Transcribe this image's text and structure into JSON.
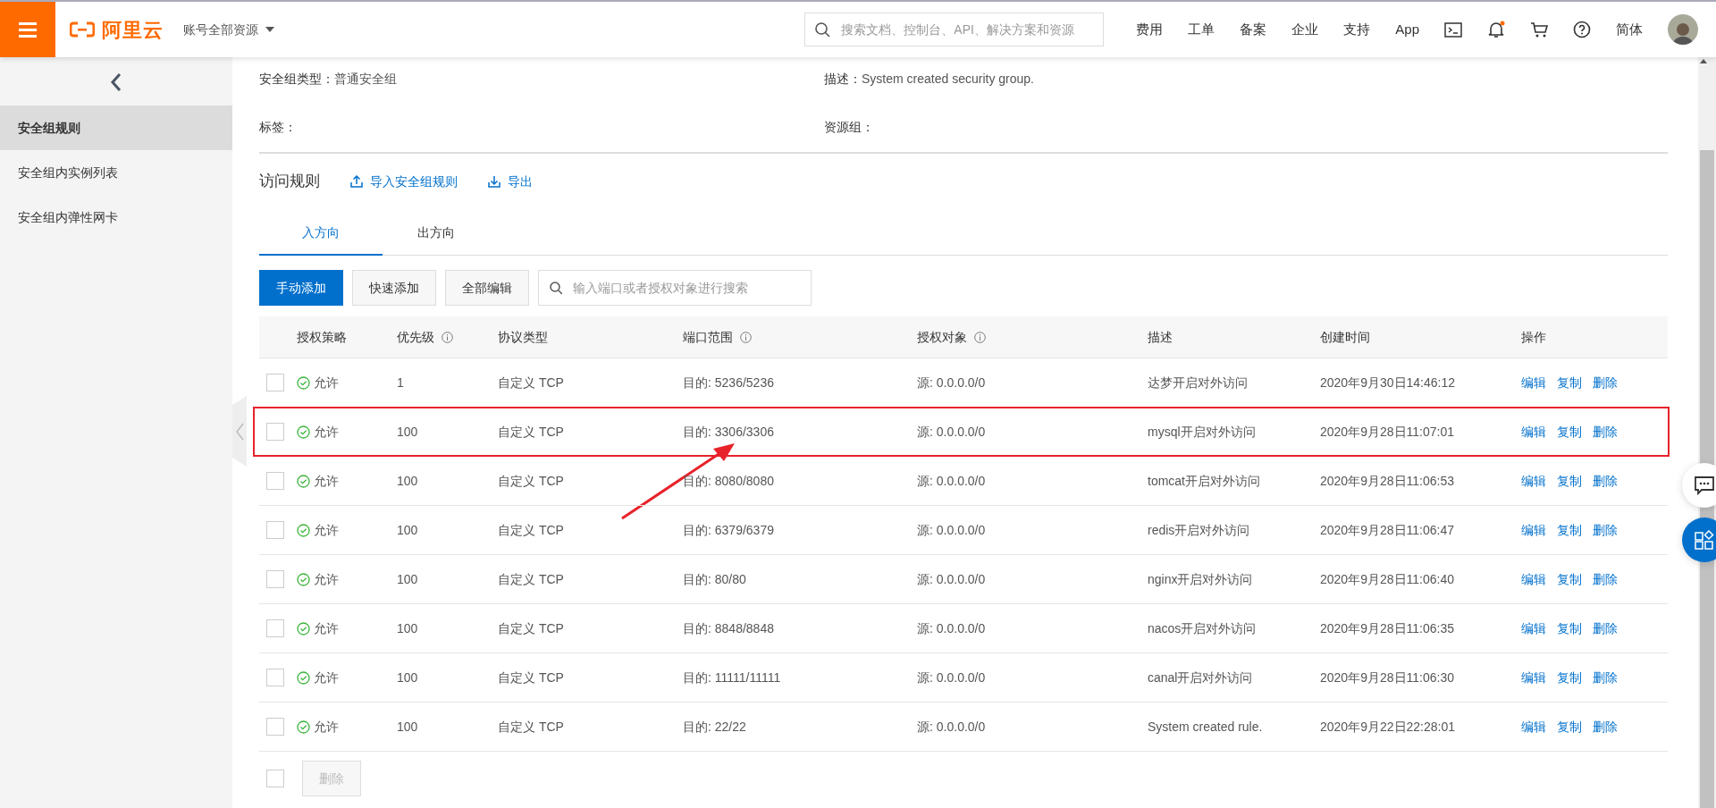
{
  "header": {
    "logo_text": "阿里云",
    "account_menu": "账号全部资源",
    "search": {
      "placeholder": "搜索文档、控制台、API、解决方案和资源"
    },
    "nav_links": [
      {
        "kind": "text",
        "label": "费用"
      },
      {
        "kind": "text",
        "label": "工单"
      },
      {
        "kind": "text",
        "label": "备案"
      },
      {
        "kind": "text",
        "label": "企业"
      },
      {
        "kind": "text",
        "label": "支持"
      },
      {
        "kind": "text",
        "label": "App"
      },
      {
        "kind": "terminal"
      },
      {
        "kind": "bell",
        "unread": true
      },
      {
        "kind": "cart"
      },
      {
        "kind": "help"
      },
      {
        "kind": "text",
        "label": "简体"
      },
      {
        "kind": "avatar"
      }
    ]
  },
  "sidebar": {
    "items": [
      {
        "label": "安全组规则",
        "selected": true
      },
      {
        "label": "安全组内实例列表",
        "selected": false
      },
      {
        "label": "安全组内弹性网卡",
        "selected": false
      }
    ]
  },
  "details": [
    {
      "label": "安全组类型：",
      "value": "普通安全组"
    },
    {
      "label": "描述：",
      "value": "System created security group."
    },
    {
      "label": "标签："
    },
    {
      "label": "资源组："
    }
  ],
  "section": {
    "title": "访问规则",
    "actions": [
      {
        "kind": "upload",
        "label": "导入安全组规则"
      },
      {
        "kind": "download",
        "label": "导出"
      }
    ]
  },
  "tabs": [
    {
      "label": "入方向",
      "selected": true
    },
    {
      "label": "出方向",
      "selected": false
    }
  ],
  "toolbar": {
    "buttons": [
      {
        "kind": "primary",
        "label": "手动添加"
      },
      {
        "kind": "default",
        "label": "快速添加"
      },
      {
        "kind": "default",
        "label": "全部编辑"
      }
    ],
    "search": {
      "placeholder": "输入端口或者授权对象进行搜索"
    }
  },
  "table": {
    "columns": [
      {
        "label": "授权策略",
        "info": false
      },
      {
        "label": "优先级",
        "info": true
      },
      {
        "label": "协议类型",
        "info": false
      },
      {
        "label": "端口范围",
        "info": true
      },
      {
        "label": "授权对象",
        "info": true
      },
      {
        "label": "描述",
        "info": false
      },
      {
        "label": "创建时间",
        "info": false
      },
      {
        "label": "操作",
        "info": false
      }
    ],
    "rows": [
      {
        "checked": false,
        "highlighted": false,
        "policy": "允许",
        "priority": "1",
        "protocol": "自定义 TCP",
        "port": "目的: 5236/5236",
        "source": "源: 0.0.0.0/0",
        "description": "达梦开启对外访问",
        "created": "2020年9月30日14:46:12",
        "actions": [
          "编辑",
          "复制",
          "删除"
        ]
      },
      {
        "checked": false,
        "highlighted": true,
        "policy": "允许",
        "priority": "100",
        "protocol": "自定义 TCP",
        "port": "目的: 3306/3306",
        "source": "源: 0.0.0.0/0",
        "description": "mysql开启对外访问",
        "created": "2020年9月28日11:07:01",
        "actions": [
          "编辑",
          "复制",
          "删除"
        ]
      },
      {
        "checked": false,
        "highlighted": false,
        "policy": "允许",
        "priority": "100",
        "protocol": "自定义 TCP",
        "port": "目的: 8080/8080",
        "source": "源: 0.0.0.0/0",
        "description": "tomcat开启对外访问",
        "created": "2020年9月28日11:06:53",
        "actions": [
          "编辑",
          "复制",
          "删除"
        ]
      },
      {
        "checked": false,
        "highlighted": false,
        "policy": "允许",
        "priority": "100",
        "protocol": "自定义 TCP",
        "port": "目的: 6379/6379",
        "source": "源: 0.0.0.0/0",
        "description": "redis开启对外访问",
        "created": "2020年9月28日11:06:47",
        "actions": [
          "编辑",
          "复制",
          "删除"
        ]
      },
      {
        "checked": false,
        "highlighted": false,
        "policy": "允许",
        "priority": "100",
        "protocol": "自定义 TCP",
        "port": "目的: 80/80",
        "source": "源: 0.0.0.0/0",
        "description": "nginx开启对外访问",
        "created": "2020年9月28日11:06:40",
        "actions": [
          "编辑",
          "复制",
          "删除"
        ]
      },
      {
        "checked": false,
        "highlighted": false,
        "policy": "允许",
        "priority": "100",
        "protocol": "自定义 TCP",
        "port": "目的: 8848/8848",
        "source": "源: 0.0.0.0/0",
        "description": "nacos开启对外访问",
        "created": "2020年9月28日11:06:35",
        "actions": [
          "编辑",
          "复制",
          "删除"
        ]
      },
      {
        "checked": false,
        "highlighted": false,
        "policy": "允许",
        "priority": "100",
        "protocol": "自定义 TCP",
        "port": "目的: 11111/11111",
        "source": "源: 0.0.0.0/0",
        "description": "canal开启对外访问",
        "created": "2020年9月28日11:06:30",
        "actions": [
          "编辑",
          "复制",
          "删除"
        ]
      },
      {
        "checked": false,
        "highlighted": false,
        "policy": "允许",
        "priority": "100",
        "protocol": "自定义 TCP",
        "port": "目的: 22/22",
        "source": "源: 0.0.0.0/0",
        "description": "System created rule.",
        "created": "2020年9月22日22:28:01",
        "actions": [
          "编辑",
          "复制",
          "删除"
        ]
      }
    ]
  },
  "footer": {
    "select_all_checked": false,
    "delete_button": {
      "label": "删除",
      "disabled": true
    }
  }
}
